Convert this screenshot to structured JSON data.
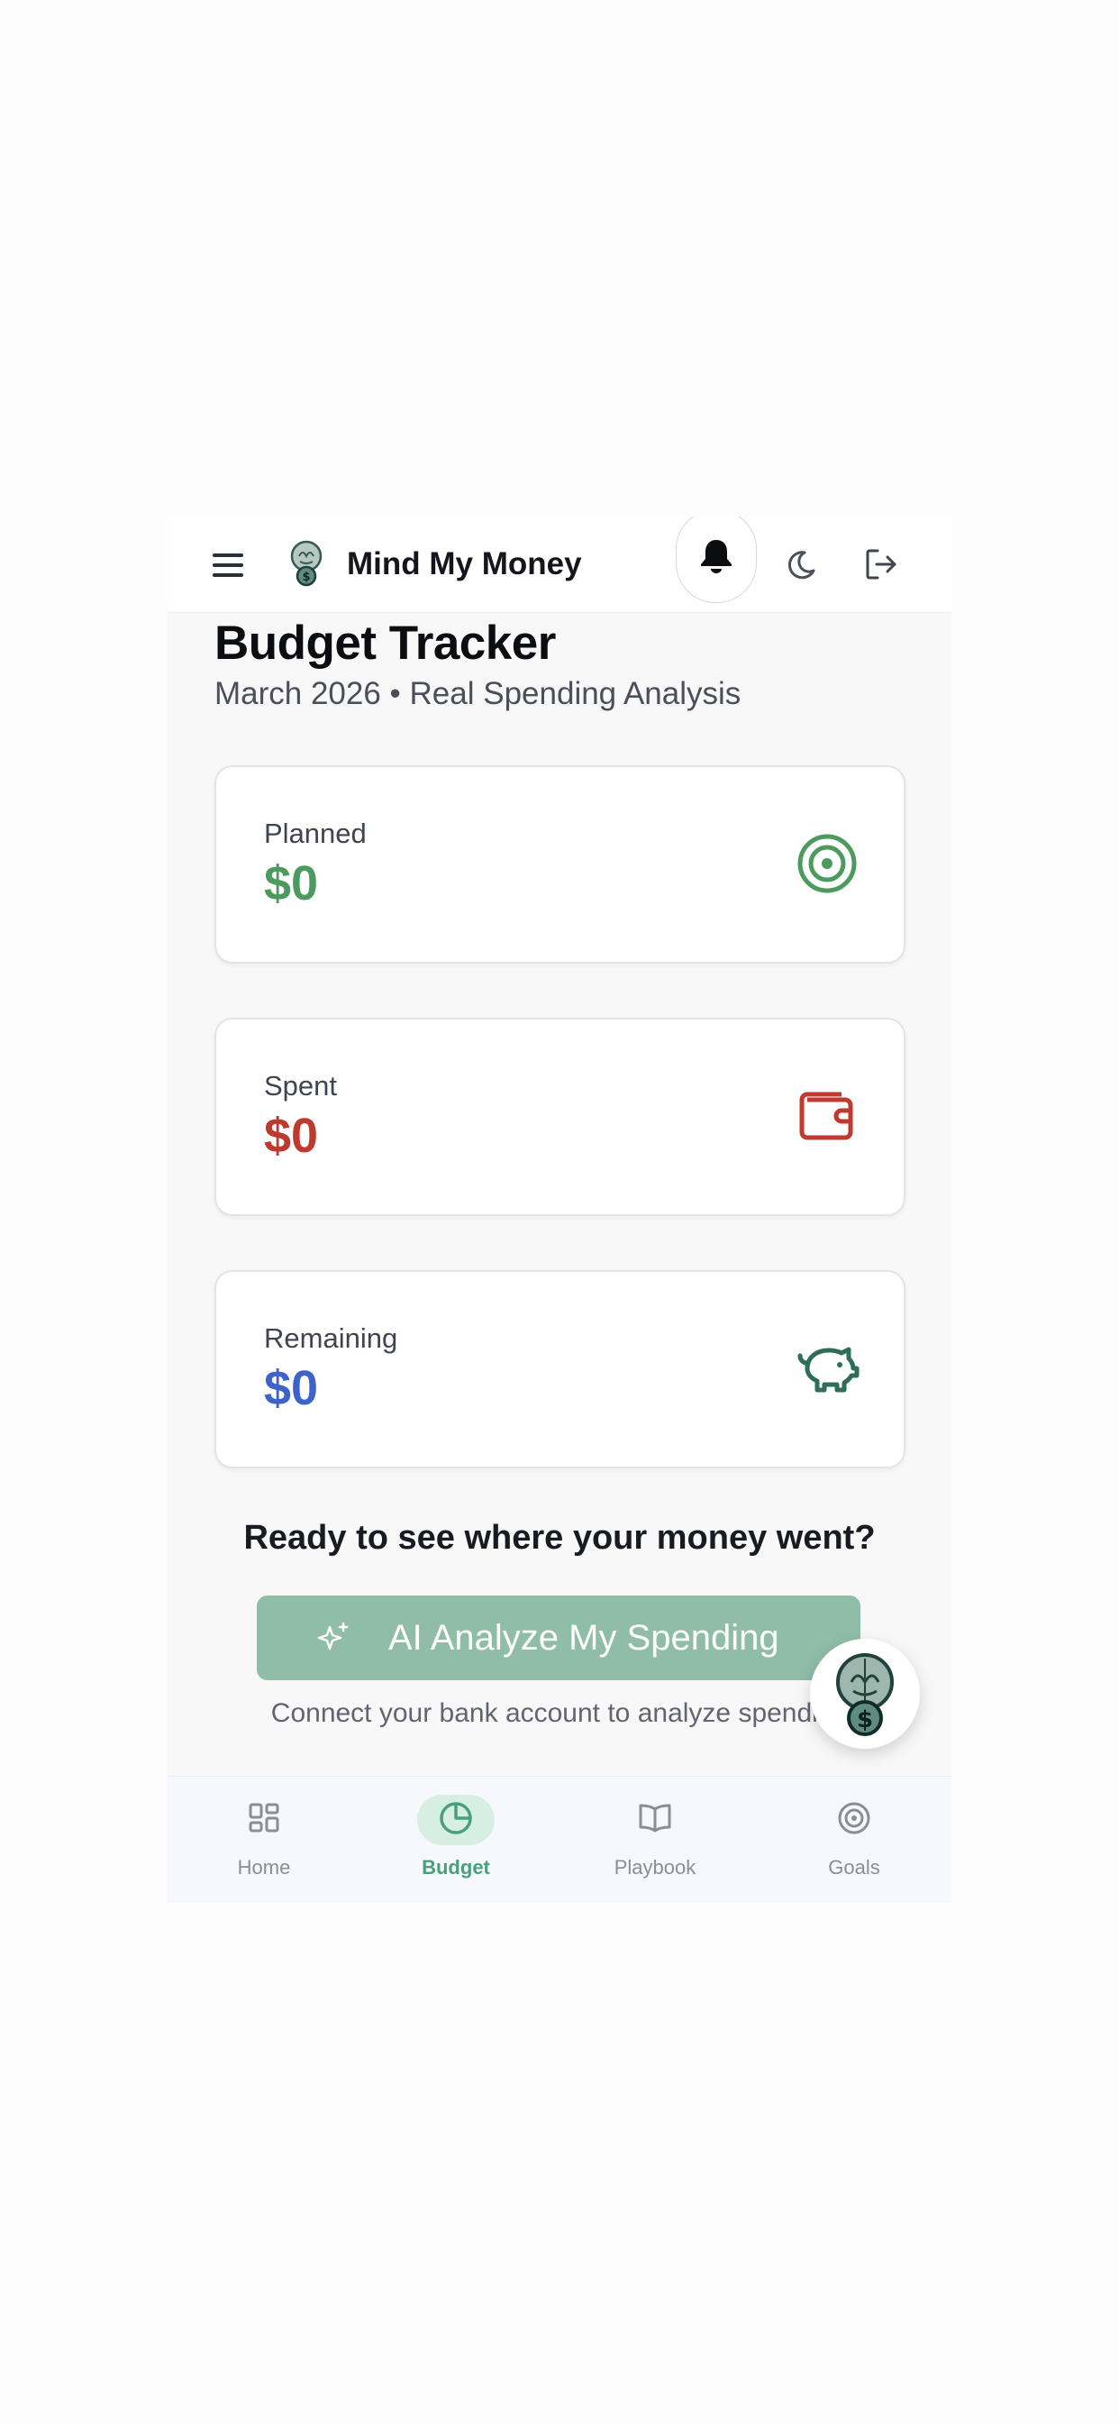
{
  "app": {
    "title": "Mind My Money"
  },
  "page": {
    "title": "Budget Tracker",
    "subtitle": "March 2026 • Real Spending Analysis"
  },
  "cards": [
    {
      "label": "Planned",
      "value": "$0",
      "color": "#4c9a5e",
      "icon": "target-icon"
    },
    {
      "label": "Spent",
      "value": "$0",
      "color": "#c0392f",
      "icon": "wallet-icon"
    },
    {
      "label": "Remaining",
      "value": "$0",
      "color": "#3e63c8",
      "icon": "piggy-bank-icon"
    }
  ],
  "cta": {
    "heading": "Ready to see where your money went?",
    "button_label": "AI Analyze My Spending",
    "note": "Connect your bank account to analyze spending"
  },
  "nav": {
    "active": "Budget",
    "items": [
      {
        "label": "Home",
        "icon": "grid-icon"
      },
      {
        "label": "Budget",
        "icon": "pie-chart-icon"
      },
      {
        "label": "Playbook",
        "icon": "book-icon"
      },
      {
        "label": "Goals",
        "icon": "target-icon"
      }
    ]
  },
  "colors": {
    "accent": "#49a07a",
    "button": "#8fbda8",
    "planned": "#4c9a5e",
    "spent": "#c0392f",
    "remaining": "#3e63c8"
  }
}
